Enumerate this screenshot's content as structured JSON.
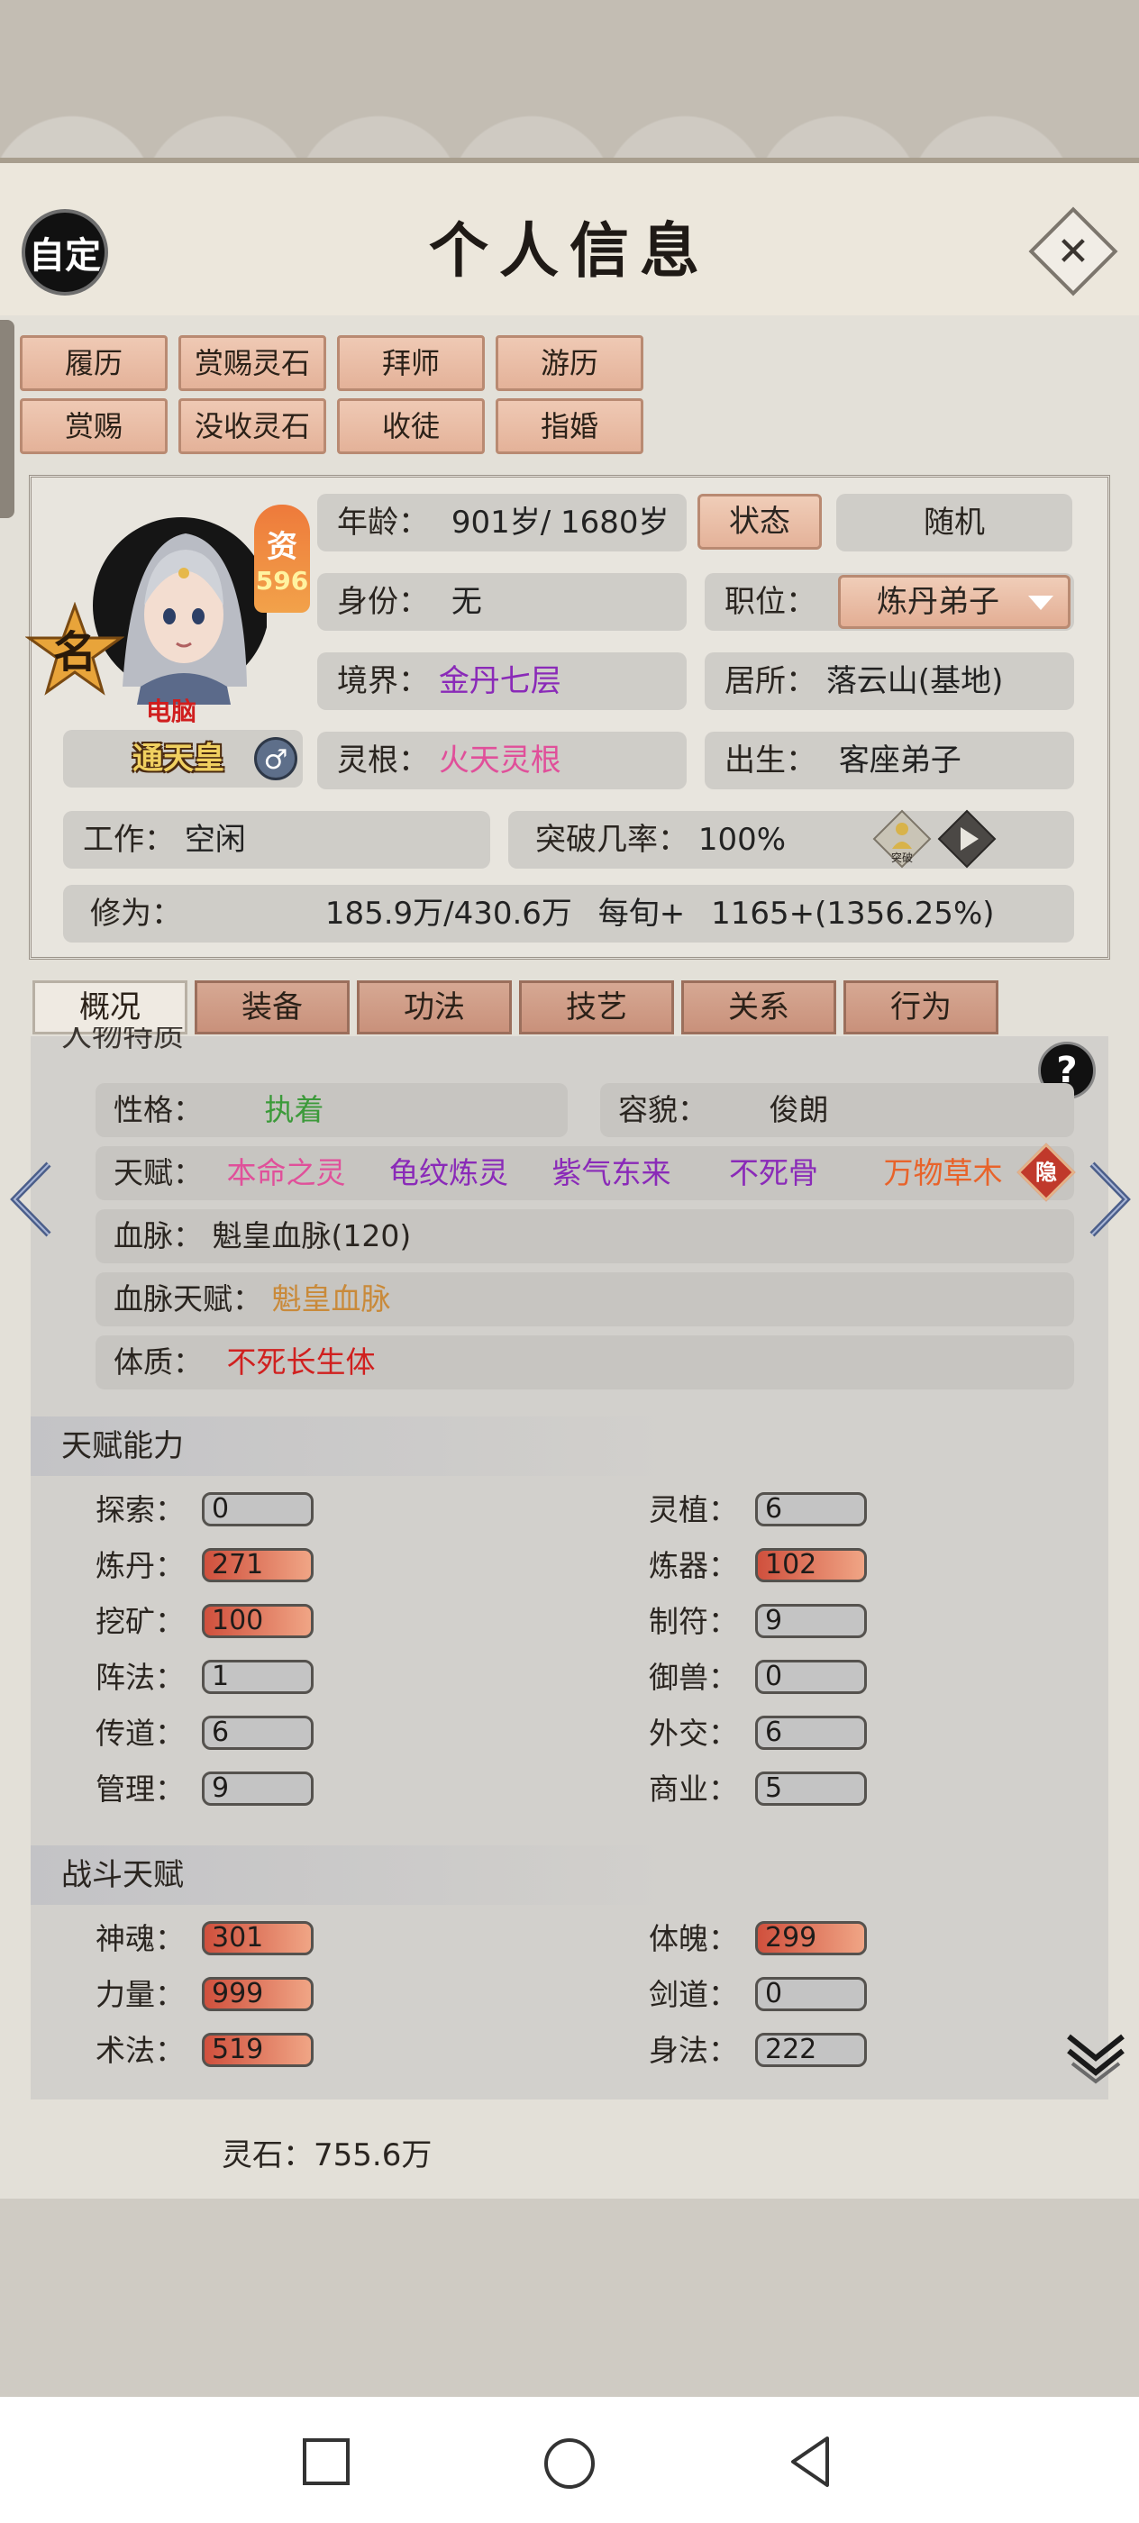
{
  "header": {
    "custom_label": "自定",
    "title": "个人信息",
    "close_icon": "close-icon"
  },
  "actions": {
    "row1": [
      "履历",
      "赏赐灵石",
      "拜师",
      "游历"
    ],
    "row2": [
      "赏赐",
      "没收灵石",
      "收徒",
      "指婚"
    ]
  },
  "profile": {
    "aptitude_label": "资",
    "aptitude_value": "596",
    "fame_label": "名",
    "controller_tag": "电脑",
    "title": "通天皇",
    "gender_icon": "male-icon",
    "age_label": "年龄：",
    "age_value": "901岁/ 1680岁",
    "status_button": "状态",
    "random_button": "随机",
    "identity_label": "身份：",
    "identity_value": "无",
    "position_label": "职位：",
    "position_value": "炼丹弟子",
    "realm_label": "境界：",
    "realm_value": "金丹七层",
    "residence_label": "居所：",
    "residence_value": "落云山(基地)",
    "root_label": "灵根：",
    "root_value": "火天灵根",
    "birth_label": "出生：",
    "birth_value": "客座弟子",
    "work_label": "工作：",
    "work_value": "空闲",
    "breakthrough_label": "突破几率：",
    "breakthrough_value": "100%",
    "breakthrough_icon_text": "突破",
    "cultivation_label": "修为：",
    "cultivation_value": "185.9万/430.6万",
    "per_period_label": "每旬+",
    "per_period_value": "1165+(1356.25%)"
  },
  "tabs": [
    "概况",
    "装备",
    "功法",
    "技艺",
    "关系",
    "行为"
  ],
  "active_tab": "概况",
  "overview": {
    "clipped_header": "人物特质",
    "personality_label": "性格：",
    "personality_value": "执着",
    "appearance_label": "容貌：",
    "appearance_value": "俊朗",
    "talent_label": "天赋：",
    "talents": [
      "本命之灵",
      "龟纹炼灵",
      "紫气东来",
      "不死骨",
      "万物草木"
    ],
    "hide_label": "隐",
    "bloodline_label": "血脉：",
    "bloodline_value": "魁皇血脉(120)",
    "bloodline_talent_label": "血脉天赋：",
    "bloodline_talent_value": "魁皇血脉",
    "physique_label": "体质：",
    "physique_value": "不死长生体"
  },
  "talent_abilities": {
    "header": "天赋能力",
    "items": [
      {
        "label": "探索：",
        "value": "0"
      },
      {
        "label": "灵植：",
        "value": "6"
      },
      {
        "label": "炼丹：",
        "value": "271"
      },
      {
        "label": "炼器：",
        "value": "102"
      },
      {
        "label": "挖矿：",
        "value": "100"
      },
      {
        "label": "制符：",
        "value": "9"
      },
      {
        "label": "阵法：",
        "value": "1"
      },
      {
        "label": "御兽：",
        "value": "0"
      },
      {
        "label": "传道：",
        "value": "6"
      },
      {
        "label": "外交：",
        "value": "6"
      },
      {
        "label": "管理：",
        "value": "9"
      },
      {
        "label": "商业：",
        "value": "5"
      }
    ]
  },
  "combat_talents": {
    "header": "战斗天赋",
    "items": [
      {
        "label": "神魂：",
        "value": "301"
      },
      {
        "label": "体魄：",
        "value": "299"
      },
      {
        "label": "力量：",
        "value": "999"
      },
      {
        "label": "剑道：",
        "value": "0"
      },
      {
        "label": "术法：",
        "value": "519"
      },
      {
        "label": "身法：",
        "value": "222"
      }
    ]
  },
  "footer": {
    "spirit_stone": "灵石：755.6万"
  },
  "help_label": "?",
  "colors": {
    "tab_brown": "#c9917b",
    "button_peach": "#e4b299",
    "hot_bar": "#d0503d",
    "purple_text": "#8a2ab8",
    "red_text": "#d0201f"
  }
}
